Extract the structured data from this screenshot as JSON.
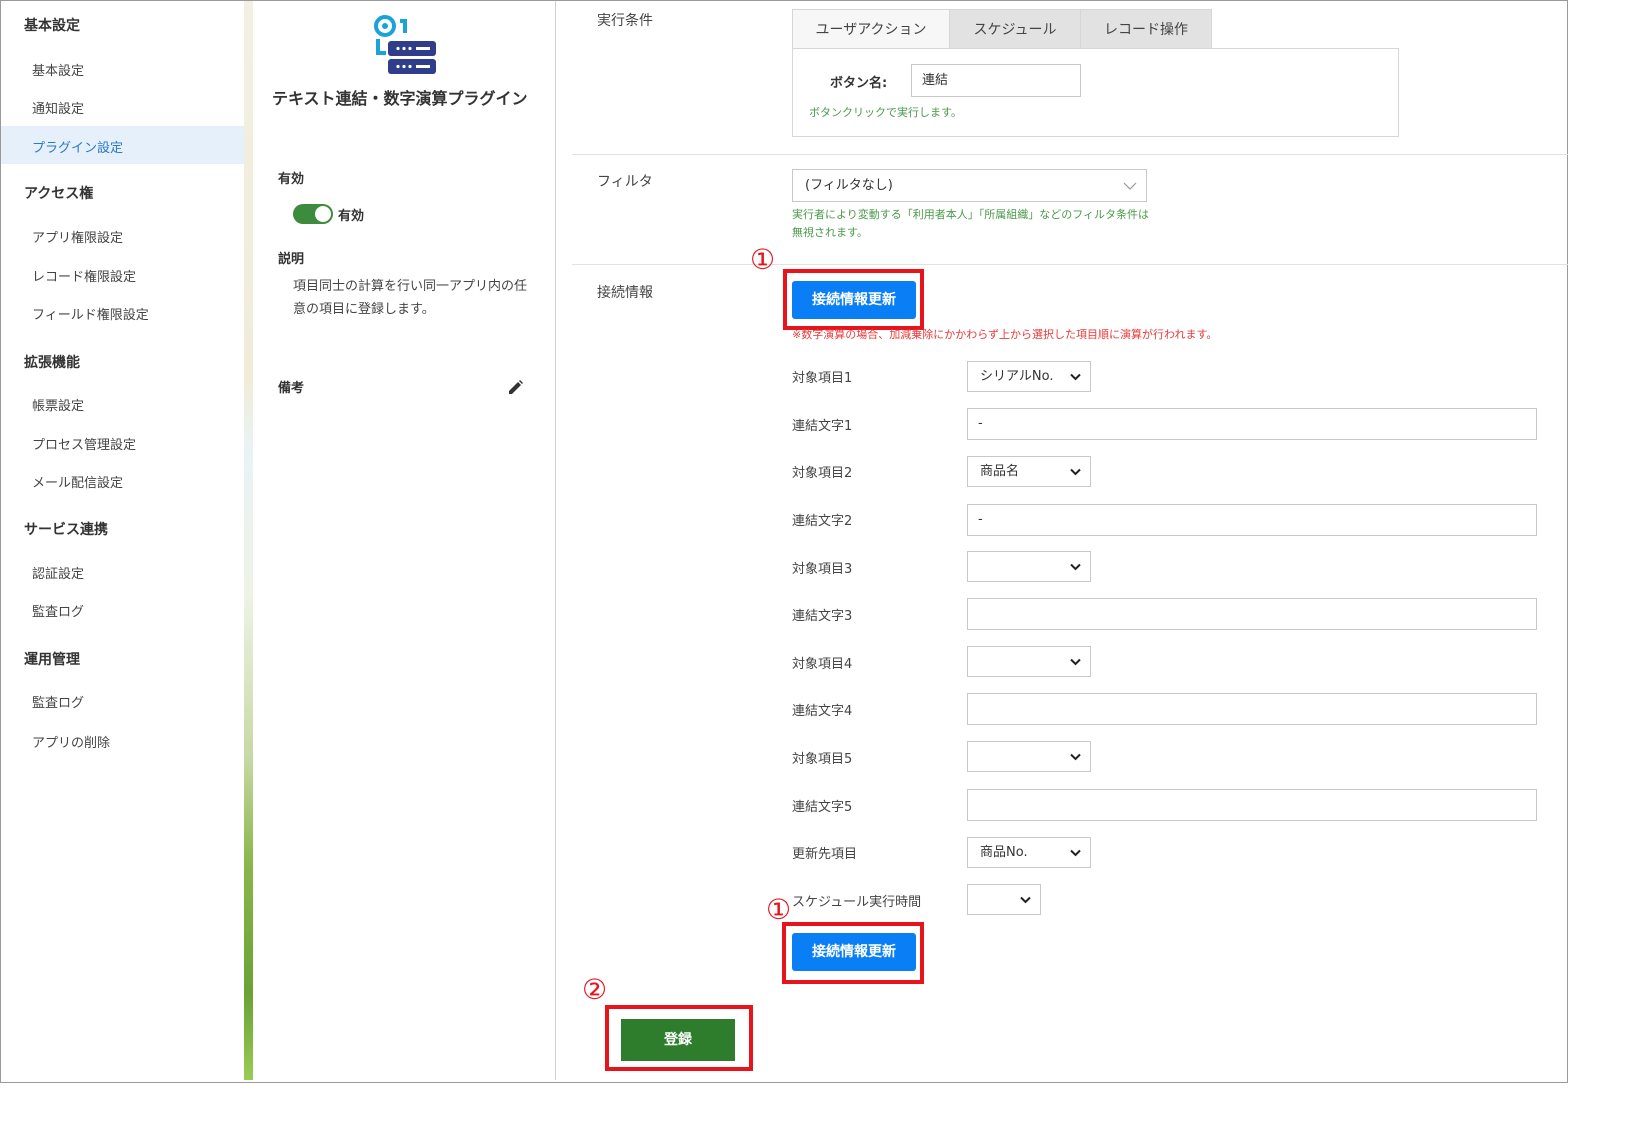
{
  "sidebar": {
    "sections": [
      {
        "title": "基本設定",
        "items": [
          "基本設定",
          "通知設定",
          "プラグイン設定"
        ]
      },
      {
        "title": "アクセス権",
        "items": [
          "アプリ権限設定",
          "レコード権限設定",
          "フィールド権限設定"
        ]
      },
      {
        "title": "拡張機能",
        "items": [
          "帳票設定",
          "プロセス管理設定",
          "メール配信設定"
        ]
      },
      {
        "title": "サービス連携",
        "items": [
          "認証設定",
          "監査ログ"
        ]
      },
      {
        "title": "運用管理",
        "items": [
          "監査ログ",
          "アプリの削除"
        ]
      }
    ],
    "active_item": "プラグイン設定"
  },
  "plugin": {
    "title": "テキスト連結・数字演算プラグイン",
    "enabled_heading": "有効",
    "toggle_label": "有効",
    "toggle_on": true,
    "description_heading": "説明",
    "description": "項目同士の計算を行い同一アプリ内の任意の項目に登録します。",
    "notes_heading": "備考"
  },
  "form": {
    "execution_condition_label": "実行条件",
    "tabs": [
      "ユーザアクション",
      "スケジュール",
      "レコード操作"
    ],
    "active_tab": "ユーザアクション",
    "button_name_label": "ボタン名:",
    "button_name_value": "連結",
    "button_name_note": "ボタンクリックで実行します。",
    "filter_label": "フィルタ",
    "filter_value": "(フィルタなし)",
    "filter_note": "実行者により変動する「利用者本人」「所属組織」などのフィルタ条件は無視されます。",
    "connection_label": "接続情報",
    "update_button": "接続情報更新",
    "warning": "※数字演算の場合、加減乗除にかかわらず上から選択した項目順に演算が行われます。",
    "fields": [
      {
        "label": "対象項目1",
        "type": "select",
        "value": "シリアルNo."
      },
      {
        "label": "連結文字1",
        "type": "text",
        "value": "-"
      },
      {
        "label": "対象項目2",
        "type": "select",
        "value": "商品名"
      },
      {
        "label": "連結文字2",
        "type": "text",
        "value": "-"
      },
      {
        "label": "対象項目3",
        "type": "select",
        "value": ""
      },
      {
        "label": "連結文字3",
        "type": "text",
        "value": ""
      },
      {
        "label": "対象項目4",
        "type": "select",
        "value": ""
      },
      {
        "label": "連結文字4",
        "type": "text",
        "value": ""
      },
      {
        "label": "対象項目5",
        "type": "select",
        "value": ""
      },
      {
        "label": "連結文字5",
        "type": "text",
        "value": ""
      },
      {
        "label": "更新先項目",
        "type": "select",
        "value": "商品No."
      }
    ],
    "schedule_time_label": "スケジュール実行時間",
    "schedule_time_value": "",
    "submit_button": "登録"
  },
  "annotations": {
    "marker_1": "①",
    "marker_2": "②",
    "highlight_color": "#e8141c"
  },
  "colors": {
    "primary_blue": "#0a7ff5",
    "submit_green": "#2d7d2d",
    "toggle_green": "#3d8b3d",
    "active_link": "#2a78c8"
  }
}
